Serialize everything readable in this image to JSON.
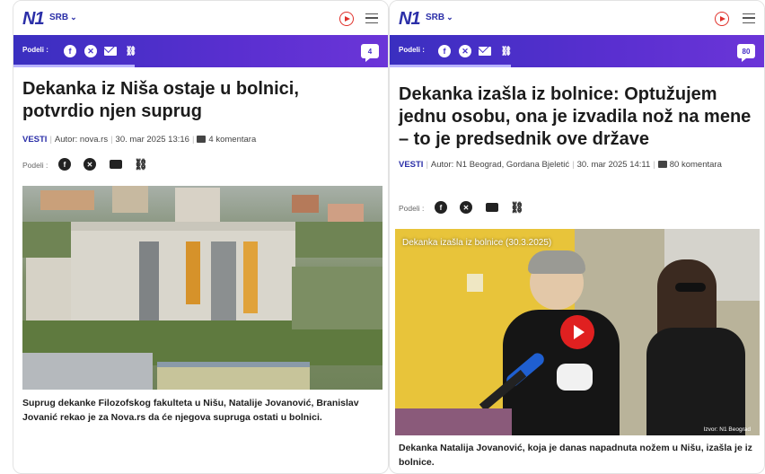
{
  "left": {
    "logo": "N1",
    "region": "SRB",
    "share_label": "Podeli :",
    "comment_count": "4",
    "headline": "Dekanka iz Niša ostaje u bolnici, potvrdio njen suprug",
    "meta": {
      "category": "VESTI",
      "author_label": "Autor:",
      "author": "nova.rs",
      "date": "30. mar 2025 13:16",
      "comments": "4 komentara"
    },
    "share_row_label": "Podeli :",
    "caption": "Suprug dekanke Filozofskog fakulteta u Nišu, Natalije Jovanović, Branislav Jovanić rekao je za Nova.rs da će njegova supruga ostati u bolnici."
  },
  "right": {
    "logo": "N1",
    "region": "SRB",
    "share_label": "Podeli :",
    "comment_count": "80",
    "headline": "Dekanka izašla iz bolnice: Optužujem jednu osobu, ona je izvadila nož na mene – to je predsednik ove države",
    "meta": {
      "category": "VESTI",
      "author_label": "Autor:",
      "author": "N1 Beograd, Gordana Bjeletić",
      "date": "30. mar 2025 14:11",
      "comments_num": "80",
      "comments_word": "komentara"
    },
    "share_row_label": "Podeli :",
    "video_title": "Dekanka izašla iz bolnice (30.3.2025)",
    "video_source": "Izvor: N1 Beograd",
    "caption": "Dekanka Natalija Jovanović, koja je danas napadnuta nožem u Nišu, izašla je iz bolnice."
  },
  "icons": {
    "facebook": "f",
    "x": "✕",
    "link": "⛓"
  },
  "colors": {
    "brand": "#2b2fa8",
    "sharebar": "#4a2fc8",
    "play_red": "#e02020"
  }
}
